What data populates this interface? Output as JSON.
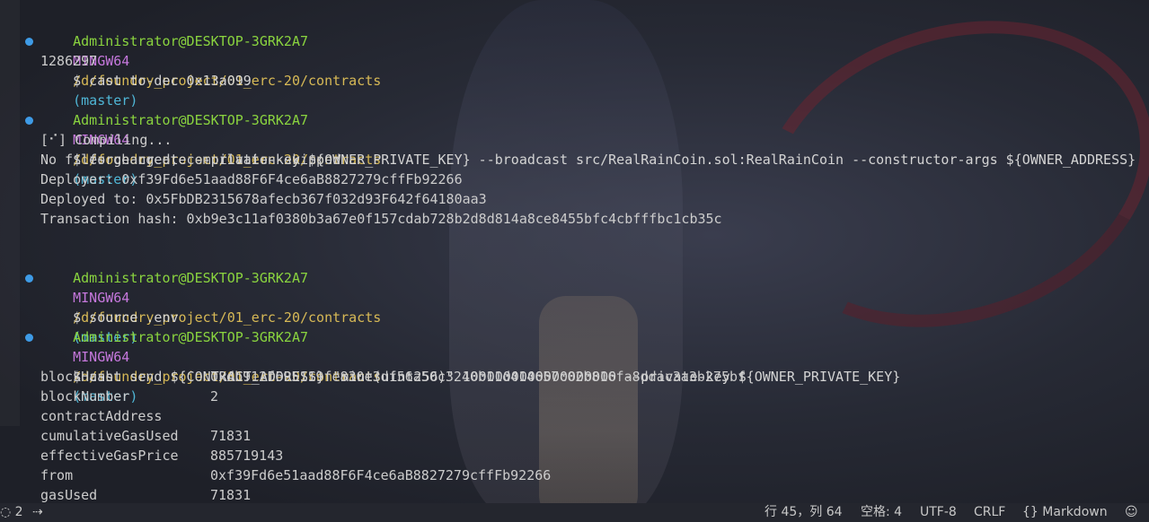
{
  "prompt": {
    "user": "Administrator@DESKTOP-3GRK2A7",
    "shell": "MINGW64",
    "path": "/d/foundry_project/01_erc-20/contracts",
    "branch": "(master)"
  },
  "block1": {
    "command": "$ cast to-dec 0x13a099",
    "output": "1286297"
  },
  "block2": {
    "command": "$ forge create --private-key ${OWNER_PRIVATE_KEY} --broadcast src/RealRainCoin.sol:RealRainCoin --constructor-args ${OWNER_ADDRESS}",
    "output": [
      "[⠊] Compiling...",
      "No files changed, compilation skipped",
      "Deployer: 0xf39Fd6e51aad88F6F4ce6aB8827279cffFb92266",
      "Deployed to: 0x5FbDB2315678afecb367f032d93F642f64180aa3",
      "Transaction hash: 0xb9e3c11af0380b3a67e0f157cdab728b2d8d814a8ce8455bfc4cbfffbc1cb35c"
    ]
  },
  "block3": {
    "command": "$ source .env"
  },
  "block4": {
    "command": "$ cast send ${CONTRACT_ADDRESS} \"mint(uint256)\" 1000000000000000000 --private-key ${OWNER_PRIVATE_KEY}",
    "receipt": [
      {
        "key": "blockHash",
        "value": "0xdb912f695119fe830e3df56a50c3240b11d414657c02b816fa8ddac3a3b275bf"
      },
      {
        "key": "blockNumber",
        "value": "2"
      },
      {
        "key": "contractAddress",
        "value": ""
      },
      {
        "key": "cumulativeGasUsed",
        "value": "71831"
      },
      {
        "key": "effectiveGasPrice",
        "value": "885719143"
      },
      {
        "key": "from",
        "value": "0xf39Fd6e51aad88F6F4ce6aB8827279cffFb92266"
      },
      {
        "key": "gasUsed",
        "value": "71831"
      }
    ]
  },
  "statusbar": {
    "left_count": "2",
    "position": "行 45，列 64",
    "spaces": "空格: 4",
    "encoding": "UTF-8",
    "eol": "CRLF",
    "language": "Markdown",
    "language_icon": "braces-icon"
  },
  "colors": {
    "user": "#8ad43f",
    "shell": "#c678dd",
    "path": "#d7b956",
    "branch": "#4fb6d6",
    "dot": "#3e9be6"
  }
}
